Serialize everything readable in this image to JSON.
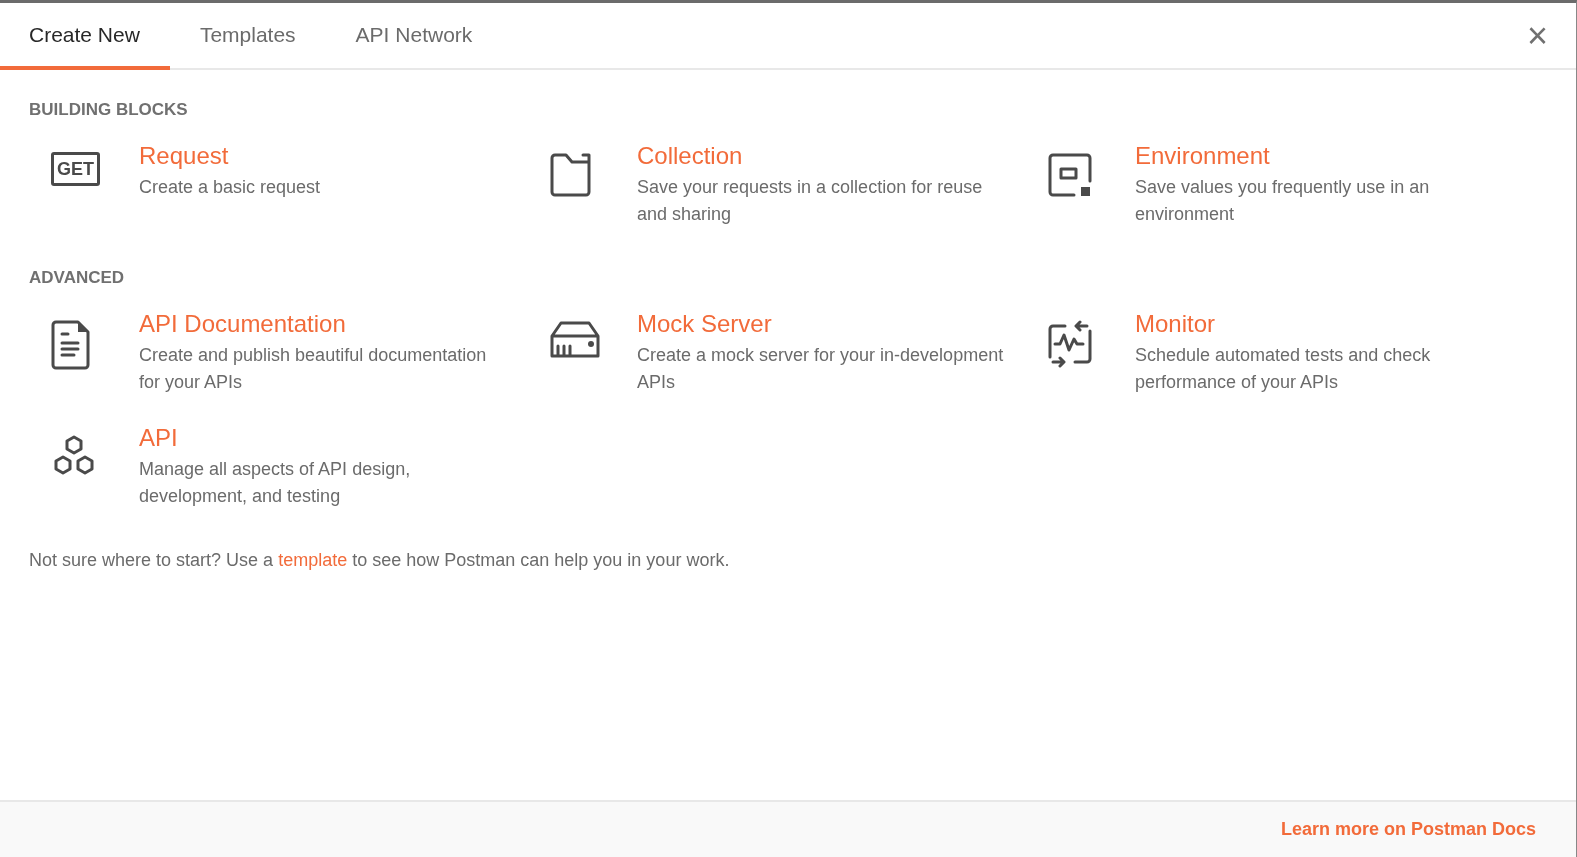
{
  "tabs": [
    {
      "label": "Create New",
      "selected": true
    },
    {
      "label": "Templates",
      "selected": false
    },
    {
      "label": "API Network",
      "selected": false
    }
  ],
  "close": {
    "label": "×"
  },
  "sections": [
    {
      "heading": "BUILDING BLOCKS",
      "items": [
        {
          "kind": "request",
          "icon_label": "GET",
          "title": "Request",
          "description": "Create a basic request"
        },
        {
          "kind": "collection",
          "title": "Collection",
          "description": "Save your requests in a collection for reuse and sharing"
        },
        {
          "kind": "environment",
          "title": "Environment",
          "description": "Save values you frequently use in an environment"
        }
      ]
    },
    {
      "heading": "ADVANCED",
      "items": [
        {
          "kind": "documentation",
          "title": "API Documentation",
          "description": "Create and publish beautiful documentation for your APIs"
        },
        {
          "kind": "mock",
          "title": "Mock Server",
          "description": "Create a mock server for your in-development APIs"
        },
        {
          "kind": "monitor",
          "title": "Monitor",
          "description": "Schedule automated tests and check performance of your APIs"
        },
        {
          "kind": "api",
          "title": "API",
          "description": "Manage all aspects of API design, development, and testing"
        }
      ]
    }
  ],
  "hint": {
    "before": "Not sure where to start? Use a",
    "link": "template",
    "after": "to see how Postman can help you in your work."
  },
  "footer": {
    "link": "Learn more on Postman Docs"
  }
}
